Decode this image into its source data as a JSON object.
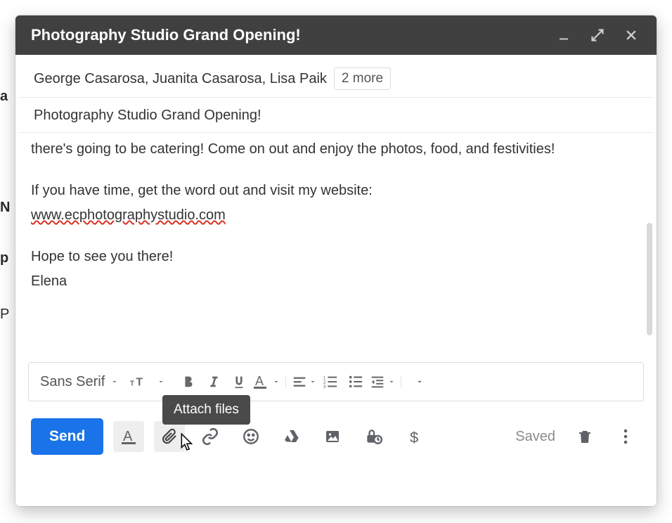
{
  "header": {
    "title": "Photography Studio Grand Opening!"
  },
  "to": {
    "recipients_text": "George Casarosa, Juanita Casarosa, Lisa Paik",
    "more_label": "2 more"
  },
  "subject": "Photography Studio Grand Opening!",
  "body": {
    "line1": "there's going to be catering! Come on out and enjoy the photos, food, and festivities!",
    "line2": "If you have time, get the word out and visit my website:",
    "link": "www.ecphotographystudio.com",
    "line3": "Hope to see you there!",
    "line4": "Elena"
  },
  "format_bar": {
    "font_name": "Sans Serif"
  },
  "tooltip": {
    "attach": "Attach files"
  },
  "actions": {
    "send": "Send",
    "saved": "Saved"
  },
  "bg_letters": {
    "a": "a",
    "n": "N",
    "p": "p",
    "p2": "P"
  }
}
